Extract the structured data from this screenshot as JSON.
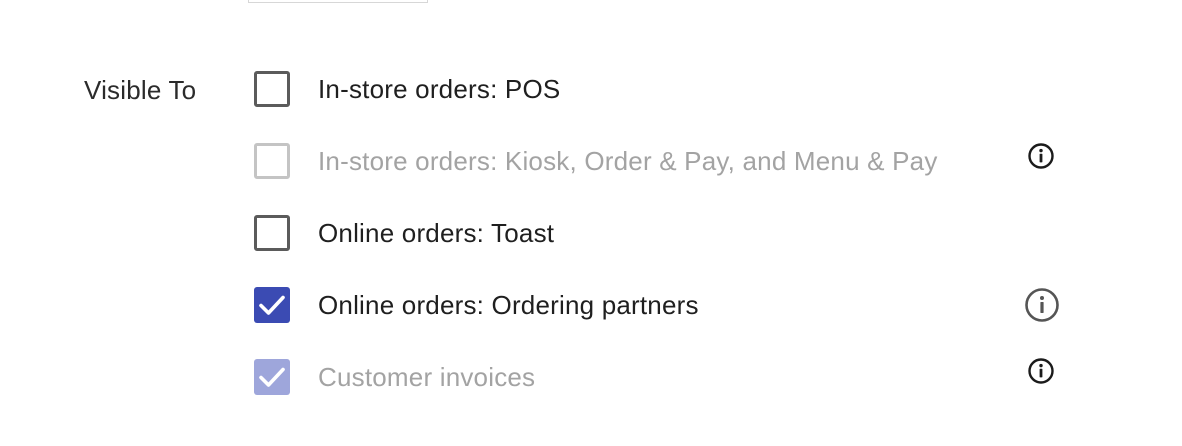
{
  "form": {
    "visible_to_label": "Visible To"
  },
  "options": [
    {
      "label": "In-store orders: POS",
      "checked": false,
      "disabled": false,
      "info": false
    },
    {
      "label": "In-store orders: Kiosk, Order & Pay, and Menu & Pay",
      "checked": false,
      "disabled": true,
      "info": true
    },
    {
      "label": "Online orders: Toast",
      "checked": false,
      "disabled": false,
      "info": false
    },
    {
      "label": "Online orders: Ordering partners",
      "checked": true,
      "disabled": false,
      "info": true
    },
    {
      "label": "Customer invoices",
      "checked": true,
      "disabled": true,
      "info": true
    }
  ],
  "colors": {
    "checked": "#3b4bb3",
    "checked_disabled": "#9ea6db",
    "text": "#1f1f1f",
    "text_disabled": "#a3a3a3",
    "border": "#5b5b5b",
    "border_disabled": "#c4c4c4"
  },
  "icons": {
    "checkmark": "checkmark-icon",
    "info": "info-icon"
  }
}
